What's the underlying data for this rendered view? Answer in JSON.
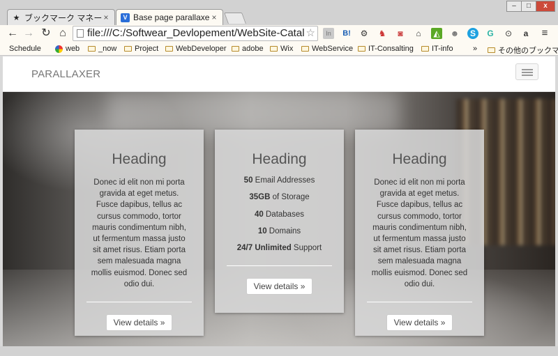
{
  "browser": {
    "tabs": [
      {
        "title": "ブックマーク マネージャ",
        "close": "×",
        "favicon": "star-icon"
      },
      {
        "title": "Base page parallaxer",
        "close": "×",
        "favicon": "v-logo-icon"
      }
    ],
    "window_controls": {
      "minimize": "–",
      "maximize": "□",
      "close": "x"
    },
    "address": "file:///C:/Softwear_Devlopement/WebSite-Catalo",
    "extensions": [
      "In",
      "B!",
      "⚙",
      "♞",
      "◙",
      "⌂",
      "◭",
      "☻",
      "S",
      "G",
      "⊙",
      "a",
      "≡"
    ],
    "bookmarks": [
      "Schedule",
      "web",
      "_now",
      "Project",
      "WebDeveloper",
      "adobe",
      "Wix",
      "WebService",
      "IT-Consalting",
      "IT-info"
    ],
    "bookmarks_overflow": "»",
    "other_bookmarks": "その他のブックマーク"
  },
  "page": {
    "brand": "PARALLAXER",
    "cards": [
      {
        "heading": "Heading",
        "body": "Donec id elit non mi porta gravida at eget metus. Fusce dapibus, tellus ac cursus commodo, tortor mauris condimentum nibh, ut fermentum massa justo sit amet risus. Etiam porta sem malesuada magna mollis euismod. Donec sed odio dui.",
        "button": "View details »"
      },
      {
        "heading": "Heading",
        "features": [
          {
            "strong": "50",
            "text": " Email Addresses"
          },
          {
            "strong": "35GB",
            "text": " of Storage"
          },
          {
            "strong": "40",
            "text": " Databases"
          },
          {
            "strong": "10",
            "text": " Domains"
          },
          {
            "strong": "24/7 Unlimited",
            "text": " Support"
          }
        ],
        "button": "View details »"
      },
      {
        "heading": "Heading",
        "body": "Donec id elit non mi porta gravida at eget metus. Fusce dapibus, tellus ac cursus commodo, tortor mauris condimentum nibh, ut fermentum massa justo sit amet risus. Etiam porta sem malesuada magna mollis euismod. Donec sed odio dui.",
        "button": "View details »"
      }
    ]
  }
}
